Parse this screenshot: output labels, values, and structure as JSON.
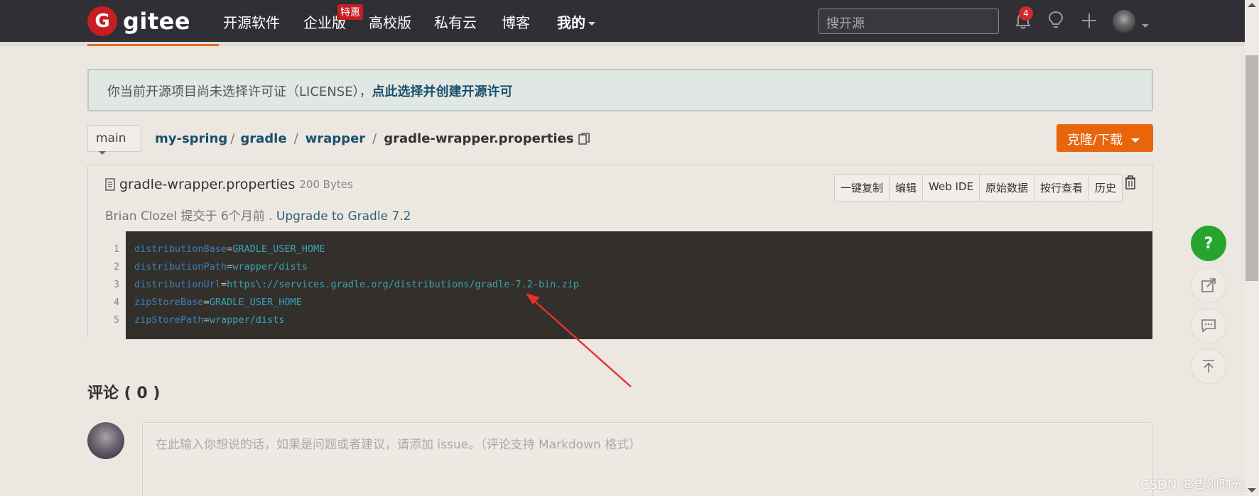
{
  "nav": {
    "logo": "gitee",
    "items": [
      "开源软件",
      "企业版",
      "高校版",
      "私有云",
      "博客",
      "我的"
    ],
    "enterprise_badge": "特惠",
    "search_placeholder": "搜开源",
    "notification_count": "4"
  },
  "notice": {
    "text": "你当前开源项目尚未选择许可证（LICENSE），",
    "link": "点此选择并创建开源许可"
  },
  "breadcrumb": {
    "branch": "main",
    "repo": "my-spring",
    "path": [
      "gradle",
      "wrapper"
    ],
    "file": "gradle-wrapper.properties",
    "clone_button": "克隆/下载"
  },
  "file": {
    "name": "gradle-wrapper.properties",
    "size": "200 Bytes",
    "author": "Brian Clozel",
    "committed": "提交于 6个月前 .",
    "commit_message": "Upgrade to Gradle 7.2",
    "actions": [
      "一键复制",
      "编辑",
      "Web IDE",
      "原始数据",
      "按行查看",
      "历史"
    ]
  },
  "code": {
    "line_numbers": [
      "1",
      "2",
      "3",
      "4",
      "5"
    ],
    "lines": [
      {
        "key": "distributionBase",
        "value": "GRADLE_USER_HOME"
      },
      {
        "key": "distributionPath",
        "value": "wrapper/dists"
      },
      {
        "key": "distributionUrl",
        "value": "https\\://services.gradle.org/distributions/gradle-7.2-bin.zip"
      },
      {
        "key": "zipStoreBase",
        "value": "GRADLE_USER_HOME"
      },
      {
        "key": "zipStorePath",
        "value": "wrapper/dists"
      }
    ]
  },
  "comments": {
    "title": "评论 ( 0 )",
    "placeholder": "在此输入你想说的话，如果是问题或者建议，请添加 issue。（评论支持 Markdown 格式）"
  },
  "floating": {
    "help": "?"
  },
  "watermark": "CSDN @告别时光",
  "colors": {
    "brand_red": "#c71d23",
    "clone_orange": "#e8650c",
    "help_green": "#27a42e",
    "annotation_arrow": "#e8312e"
  }
}
